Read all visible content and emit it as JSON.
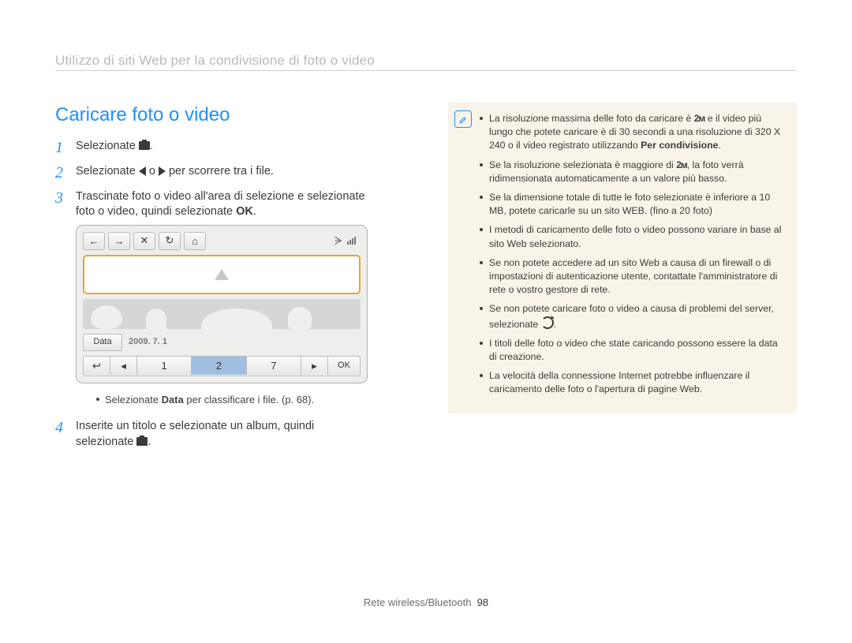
{
  "header": {
    "title": "Utilizzo di siti Web per la condivisione di foto o video"
  },
  "section_title": "Caricare foto o video",
  "steps": {
    "s1": {
      "num": "1",
      "pre": "Selezionate ",
      "post": "."
    },
    "s2": {
      "num": "2",
      "pre": "Selezionate ",
      "mid": " o ",
      "post": " per scorrere tra i file."
    },
    "s3": {
      "num": "3",
      "a": "Trascinate foto o video all'area di selezione e selezionate",
      "b": "foto o video, quindi selezionate ",
      "ok": "OK",
      "c": "."
    },
    "s4": {
      "num": "4",
      "a": "Inserite un titolo e selezionate un album, quindi",
      "b": "selezionate ",
      "c": "."
    }
  },
  "device": {
    "data_label": "Data",
    "date": "2009. 7. 1",
    "pages": [
      "1",
      "2",
      "7"
    ],
    "ok": "OK"
  },
  "note_under_device": {
    "pre": "Selezionate ",
    "bold": "Data",
    "post": " per classificare i file. (p. 68)."
  },
  "notes": [
    {
      "a": "La risoluzione massima delle foto da caricare è ",
      "res": "2м",
      "b": " e il video più lungo che potete caricare è di 30 secondi a una risoluzione di 320 X 240 o il video registrato utilizzando ",
      "bold": "Per condivisione",
      "c": "."
    },
    {
      "a": "Se la risoluzione selezionata è maggiore di ",
      "res": "2м",
      "b": ", la foto verrà ridimensionata automaticamente a un valore più basso."
    },
    {
      "a": "Se la dimensione totale di tutte le foto selezionate è inferiore a 10 MB, potete caricarle su un sito WEB. (fino a 20 foto)"
    },
    {
      "a": "I metodi di caricamento delle foto o video possono variare in base al sito Web selezionato."
    },
    {
      "a": "Se non potete accedere ad un sito Web a causa di un firewall o di impostazioni di autenticazione utente, contattate l'amministratore di rete o vostro gestore di rete."
    },
    {
      "a": "Se non potete caricare foto o video a causa di problemi del server, selezionate ",
      "icon": "refresh",
      "b": "."
    },
    {
      "a": "I titoli delle foto o video che state caricando possono essere la data di creazione."
    },
    {
      "a": "La velocità della connessione Internet potrebbe influenzare il caricamento delle foto o l'apertura di pagine Web."
    }
  ],
  "footer": {
    "section": "Rete wireless/Bluetooth",
    "page": "98"
  }
}
